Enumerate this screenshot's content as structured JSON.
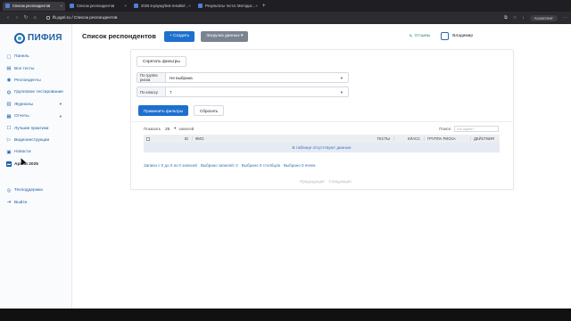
{
  "browser": {
    "tabs": [
      {
        "label": "Список респондентов",
        "active": true
      },
      {
        "label": "Список респондентов",
        "active": false
      },
      {
        "label": "2025 в-раунд/test-results/r...",
        "active": false
      },
      {
        "label": "Результаты теста: Методиc...",
        "active": false
      }
    ],
    "new_tab": "+",
    "url": "fb.pgnl.ru / Список респондентов",
    "assistant_label": "Ассистент"
  },
  "sidebar": {
    "logo_text": "ПИФИЯ",
    "items": [
      {
        "label": "Панель",
        "icon": "panel-icon",
        "glyph": "▢"
      },
      {
        "label": "Все тесты",
        "icon": "tests-icon",
        "glyph": "▤"
      },
      {
        "label": "Респонденты",
        "icon": "respondents-icon",
        "glyph": "◉"
      },
      {
        "label": "Групповое тестирование",
        "icon": "group-testing-icon",
        "glyph": "◍"
      },
      {
        "label": "Журналы",
        "icon": "journals-icon",
        "glyph": "▥",
        "chevron": "▾"
      },
      {
        "label": "Отчеты",
        "icon": "reports-icon",
        "glyph": "▦",
        "chevron": "▾"
      },
      {
        "label": "Лучшие практики",
        "icon": "best-practices-icon",
        "glyph": "☐"
      },
      {
        "label": "Видеоинструкции",
        "icon": "video-icon",
        "glyph": "▷"
      },
      {
        "label": "Новости",
        "icon": "news-icon",
        "glyph": "▣"
      },
      {
        "label": "Архив 2025",
        "icon": "archive-icon",
        "glyph": "▬",
        "active": true
      }
    ],
    "bottom": [
      {
        "label": "Техподдержка",
        "icon": "support-icon",
        "glyph": "◎"
      },
      {
        "label": "Выйти",
        "icon": "logout-icon",
        "glyph": "⇥"
      }
    ]
  },
  "header": {
    "title": "Список респондентов",
    "create_label": "+ Создать",
    "upload_label": "Загрузка данных ▾",
    "feedback_label": "Отзывы",
    "user_name": "Владимир"
  },
  "filters": {
    "hide_label": "Спрятать фильтры",
    "risk_group_label": "По группе риска",
    "risk_group_value": "Не выбрана",
    "class_label": "По классу",
    "class_value": "7",
    "apply_label": "Применить фильтры",
    "reset_label": "Сбросить"
  },
  "table": {
    "show_label": "Показать",
    "page_size": "25",
    "records_label": "записей",
    "search_label": "Поиск:",
    "search_placeholder": "Что ищете?",
    "columns": [
      "ID",
      "ФИО",
      "ТЕСТЫ",
      "КЛАСС",
      "ГРУППА РИСКА",
      "ДЕЙСТВИЯ"
    ],
    "empty_text": "В таблице отсутствуют данные",
    "summary": [
      "Записи с 0 до 0 из 0 записей",
      "Выбрано записей: 0",
      "Выбрано 0 столбцов",
      "Выбрано 0 ячеек"
    ],
    "prev_label": "Предыдущая",
    "next_label": "Следующая"
  }
}
